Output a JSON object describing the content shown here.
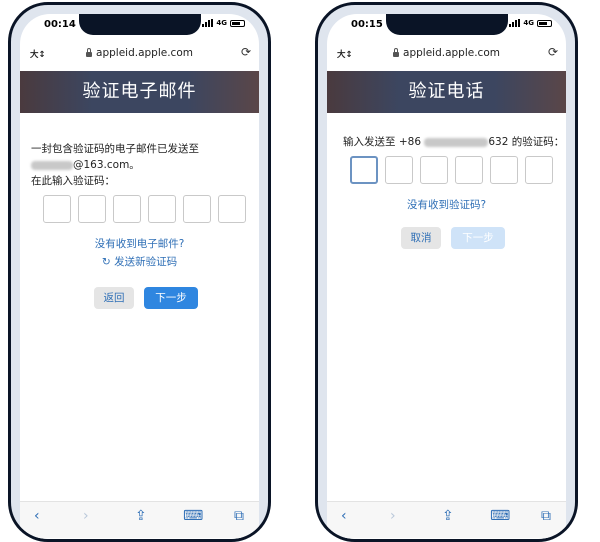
{
  "phones": [
    {
      "status": {
        "time": "00:14",
        "network": "4G"
      },
      "browser": {
        "text_size": "大↕",
        "url": "appleid.apple.com"
      },
      "page": {
        "title": "验证电子邮件",
        "message_line1": "一封包含验证码的电子邮件已发送至",
        "email_suffix": "@163.com。",
        "prompt": "在此输入验证码：",
        "no_receive_link": "没有收到电子邮件?",
        "resend_link": "发送新验证码",
        "back_button": "返回",
        "next_button": "下一步"
      }
    },
    {
      "status": {
        "time": "00:15",
        "network": "4G"
      },
      "browser": {
        "text_size": "大↕",
        "url": "appleid.apple.com"
      },
      "page": {
        "title": "验证电话",
        "prompt_prefix": "输入发送至 +86",
        "prompt_suffix": "632 的验证码：",
        "no_receive_link": "没有收到验证码?",
        "cancel_button": "取消",
        "next_button": "下一步"
      }
    }
  ],
  "colors": {
    "link": "#2f6fb6",
    "primary_button": "#2f86e0",
    "banner": "#3c4660"
  },
  "icons": [
    "back-icon",
    "forward-icon",
    "share-icon",
    "bookmarks-icon",
    "tabs-icon",
    "reload-icon",
    "lock-icon"
  ]
}
